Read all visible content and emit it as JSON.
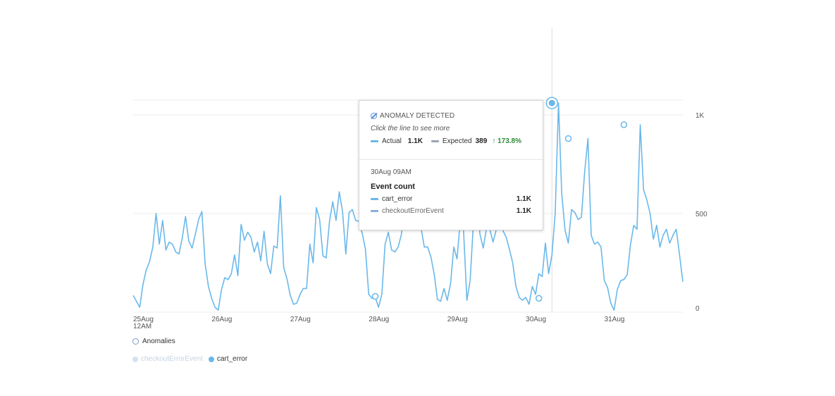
{
  "chart_data": {
    "type": "line",
    "x_ticks": [
      {
        "label": "25Aug",
        "sublabel": "12AM",
        "t": 0
      },
      {
        "label": "26Aug",
        "t": 24
      },
      {
        "label": "27Aug",
        "t": 48
      },
      {
        "label": "28Aug",
        "t": 72
      },
      {
        "label": "29Aug",
        "t": 96
      },
      {
        "label": "30Aug",
        "t": 120
      },
      {
        "label": "31Aug",
        "t": 144
      }
    ],
    "y_ticks": [
      {
        "label": "0",
        "v": 0
      },
      {
        "label": "500",
        "v": 500
      },
      {
        "label": "1K",
        "v": 1000
      }
    ],
    "ylim": [
      0,
      1100
    ],
    "xlim": [
      0,
      168
    ],
    "series": [
      {
        "name": "cart_error",
        "color": "#6ab8ea",
        "x": [
          0,
          1,
          2,
          3,
          4,
          5,
          6,
          7,
          8,
          9,
          10,
          11,
          12,
          13,
          14,
          15,
          16,
          17,
          18,
          19,
          20,
          21,
          22,
          23,
          24,
          25,
          26,
          27,
          28,
          29,
          30,
          31,
          32,
          33,
          34,
          35,
          36,
          37,
          38,
          39,
          40,
          41,
          42,
          43,
          44,
          45,
          46,
          47,
          48,
          49,
          50,
          51,
          52,
          53,
          54,
          55,
          56,
          57,
          58,
          59,
          60,
          61,
          62,
          63,
          64,
          65,
          66,
          67,
          68,
          69,
          70,
          71,
          72,
          73,
          74,
          75,
          76,
          77,
          78,
          79,
          80,
          81,
          82,
          83,
          84,
          85,
          86,
          87,
          88,
          89,
          90,
          91,
          92,
          93,
          94,
          95,
          96,
          97,
          98,
          99,
          100,
          101,
          102,
          103,
          104,
          105,
          106,
          107,
          108,
          109,
          110,
          111,
          112,
          113,
          114,
          115,
          116,
          117,
          118,
          119,
          120,
          121,
          122,
          123,
          124,
          125,
          126,
          127,
          128,
          129,
          130,
          131,
          132,
          133,
          134,
          135,
          136,
          137,
          138,
          139,
          140,
          141,
          142,
          143,
          144,
          145,
          146,
          147,
          148,
          149,
          150,
          151,
          152,
          153,
          154,
          155,
          156,
          157,
          158,
          159,
          160,
          161,
          162,
          163,
          164,
          165,
          166,
          167,
          168
        ],
        "values": [
          85,
          55,
          25,
          140,
          215,
          255,
          330,
          500,
          345,
          465,
          315,
          355,
          345,
          305,
          295,
          375,
          485,
          360,
          325,
          395,
          470,
          510,
          245,
          130,
          70,
          25,
          10,
          115,
          175,
          165,
          195,
          290,
          185,
          445,
          365,
          405,
          380,
          305,
          355,
          260,
          410,
          245,
          195,
          335,
          325,
          590,
          225,
          170,
          85,
          40,
          45,
          90,
          120,
          120,
          345,
          250,
          530,
          470,
          285,
          275,
          460,
          560,
          465,
          610,
          510,
          295,
          505,
          520,
          465,
          460,
          400,
          320,
          90,
          70,
          75,
          25,
          90,
          345,
          405,
          315,
          305,
          330,
          395,
          560,
          470,
          610,
          550,
          455,
          425,
          330,
          330,
          280,
          195,
          65,
          55,
          120,
          60,
          145,
          330,
          270,
          470,
          410,
          60,
          160,
          455,
          640,
          395,
          325,
          425,
          420,
          355,
          420,
          430,
          415,
          380,
          320,
          250,
          130,
          75,
          60,
          75,
          40,
          130,
          90,
          195,
          180,
          350,
          195,
          290,
          500,
          1060,
          600,
          415,
          350,
          520,
          505,
          470,
          480,
          710,
          880,
          390,
          345,
          355,
          330,
          160,
          125,
          45,
          10,
          115,
          160,
          165,
          190,
          340,
          440,
          420,
          950,
          620,
          570,
          500,
          370,
          440,
          330,
          390,
          420,
          350,
          390,
          420,
          290,
          155
        ],
        "anomalies": [
          {
            "t": 74,
            "v": 80
          },
          {
            "t": 103,
            "v": 815
          },
          {
            "t": 124,
            "v": 70
          },
          {
            "t": 128,
            "v": 1060
          },
          {
            "t": 133,
            "v": 880
          },
          {
            "t": 150,
            "v": 950
          }
        ]
      }
    ],
    "focus_t": 128
  },
  "legend": {
    "anomalies_label": "Anomalies",
    "series": [
      {
        "label": "checkoutErrorEvent",
        "state": "disabled"
      },
      {
        "label": "cart_error",
        "state": "active"
      }
    ]
  },
  "tooltip": {
    "header": "ANOMALY DETECTED",
    "hint": "Click the line to see more",
    "actual_label": "Actual",
    "actual_value": "1.1K",
    "expected_label": "Expected",
    "expected_value": "389",
    "delta": "↑ 173.8%",
    "date": "30Aug 09AM",
    "metric_title": "Event count",
    "rows": [
      {
        "label": "cart_error",
        "value": "1.1K"
      },
      {
        "label": "checkoutErrorEvent",
        "value": "1.1K"
      }
    ]
  },
  "colors": {
    "series": "#6ab8ea",
    "anomaly_ring": "#6ab8ea",
    "grid": "#ececec",
    "delta_positive": "#2e8b3a"
  }
}
